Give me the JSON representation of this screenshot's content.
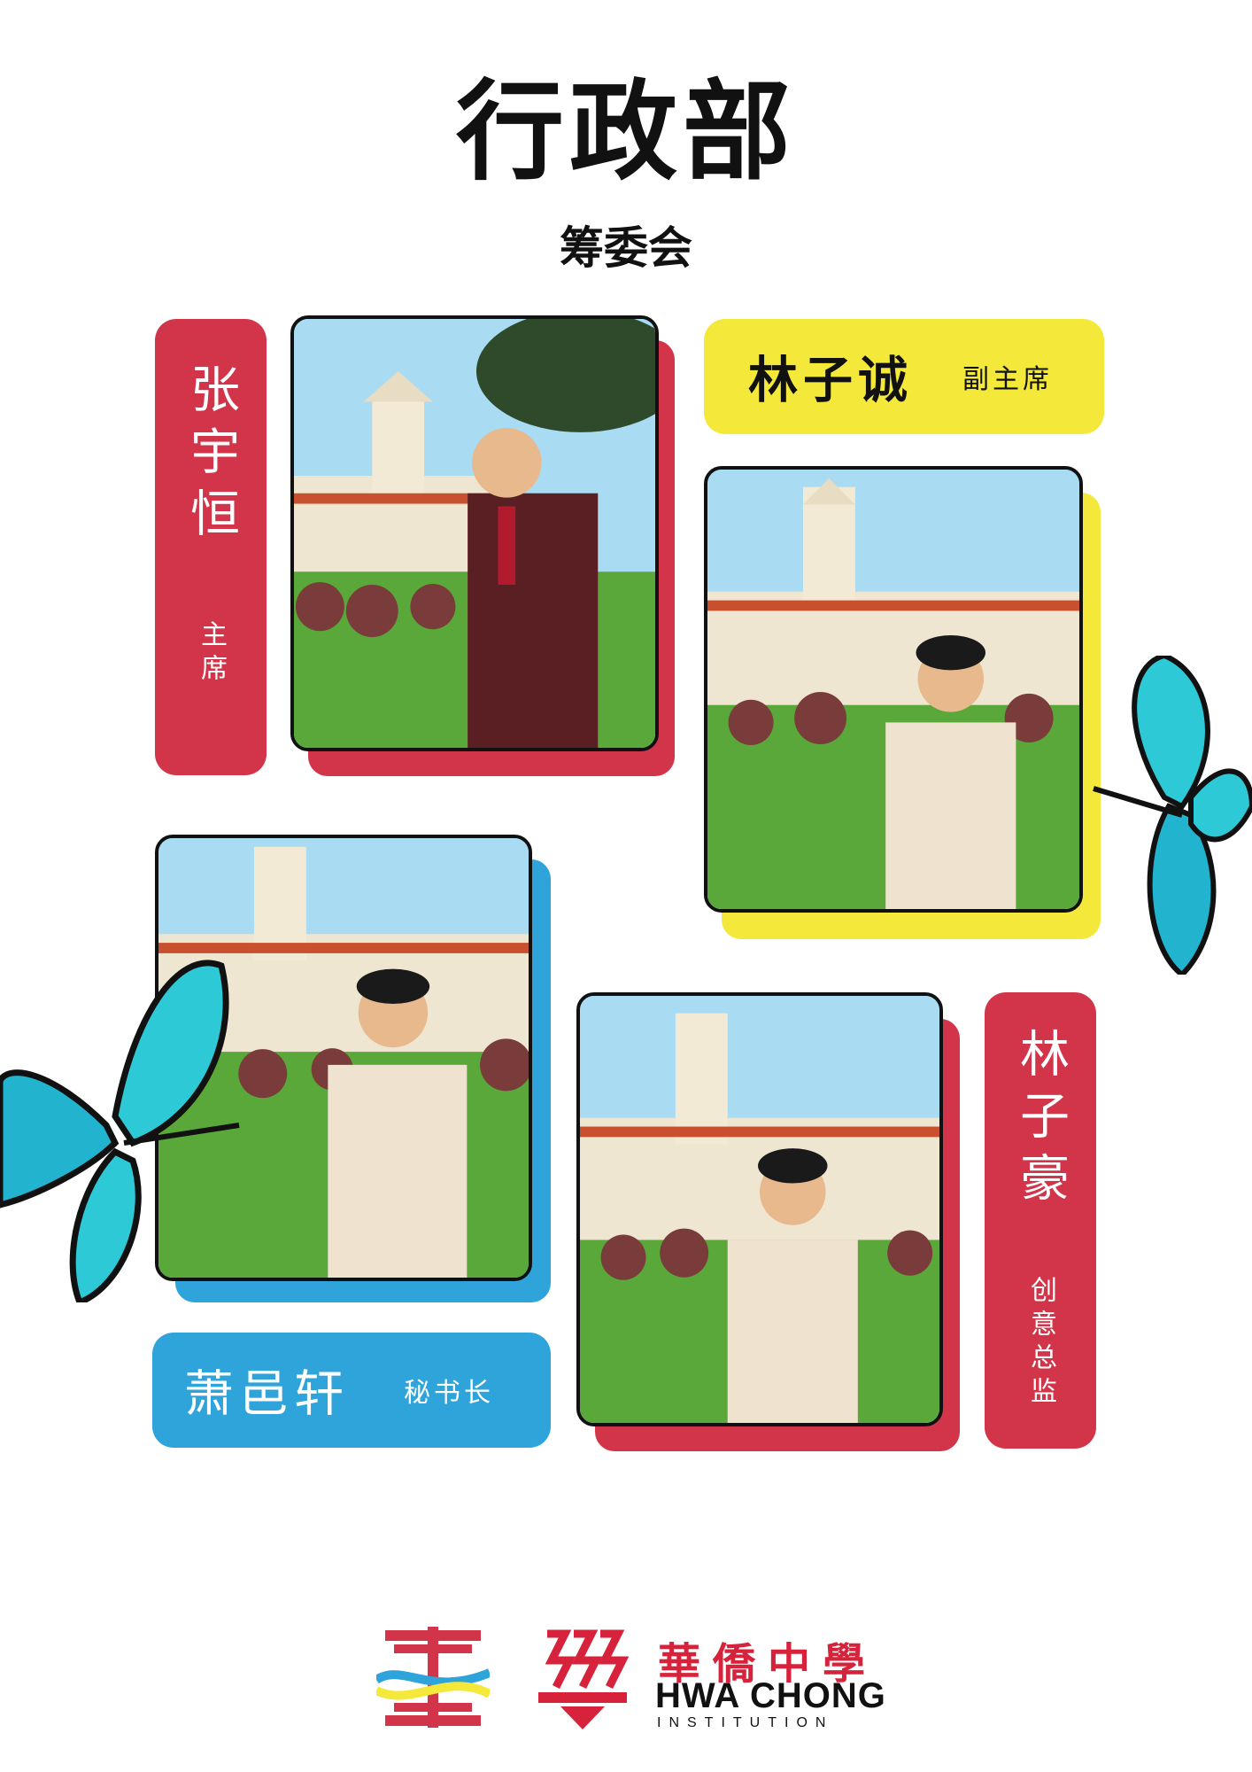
{
  "page": {
    "title": "行政部",
    "subtitle": "筹委会"
  },
  "colors": {
    "red": "#d2354a",
    "yellow": "#f4e93a",
    "blue": "#2fa4da",
    "butterfly": "#2ec9d6"
  },
  "members": [
    {
      "name": "张宇恒",
      "role": "主席",
      "card_color": "red"
    },
    {
      "name": "林子诚",
      "role": "副主席",
      "card_color": "yellow"
    },
    {
      "name": "萧邑轩",
      "role": "秘书长",
      "card_color": "blue"
    },
    {
      "name": "林子豪",
      "role": "创意总监",
      "card_color": "red"
    }
  ],
  "footer": {
    "school_cn": "華僑中學",
    "school_en": "HWA CHONG",
    "school_en_sub": "INSTITUTION"
  }
}
